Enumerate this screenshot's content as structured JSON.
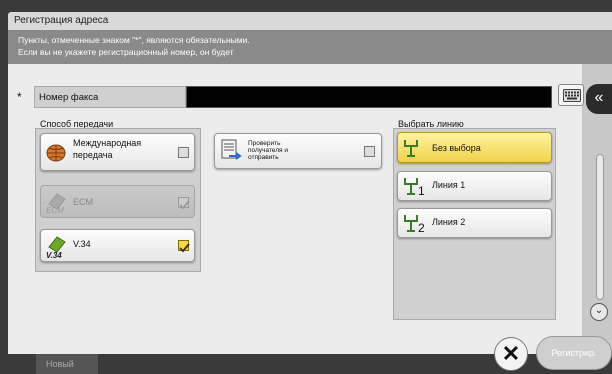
{
  "window": {
    "title": "Регистрация адреса"
  },
  "info": {
    "line1": "Пункты, отмеченные знаком \"*\", являются обязательными.",
    "line2": "Если вы не укажете регистрационный номер, он будет"
  },
  "fax_field": {
    "required_mark": "*",
    "label": "Номер факса",
    "value": ""
  },
  "transmission": {
    "title": "Способ передачи",
    "international_label_1": "Международная",
    "international_label_2": "передача",
    "international_checked": false,
    "ecm_label": "ECM",
    "ecm_icon_text": "ECM",
    "ecm_checked": true,
    "v34_label": "V.34",
    "v34_icon_text": "V.34",
    "v34_checked": true
  },
  "verify": {
    "label_1": "Проверить",
    "label_2": "получателя и",
    "label_3": "отправить",
    "checked": false
  },
  "line_select": {
    "title": "Выбрать линию",
    "options": [
      {
        "label": "Без выбора",
        "subscript": "",
        "selected": true
      },
      {
        "label": "Линия 1",
        "subscript": "1",
        "selected": false
      },
      {
        "label": "Линия 2",
        "subscript": "2",
        "selected": false
      }
    ]
  },
  "footer": {
    "tab_label": "Новый",
    "cancel_symbol": "✕",
    "register_label": "Регистрир."
  },
  "side": {
    "collapse_symbol": "«",
    "scroll_down_symbol": "⌄"
  },
  "colors": {
    "selected_yellow": "#f0d14a",
    "header_bg": "#d9d9d9",
    "info_bg": "#8a8a8a",
    "fax_input_bg": "#000000"
  }
}
